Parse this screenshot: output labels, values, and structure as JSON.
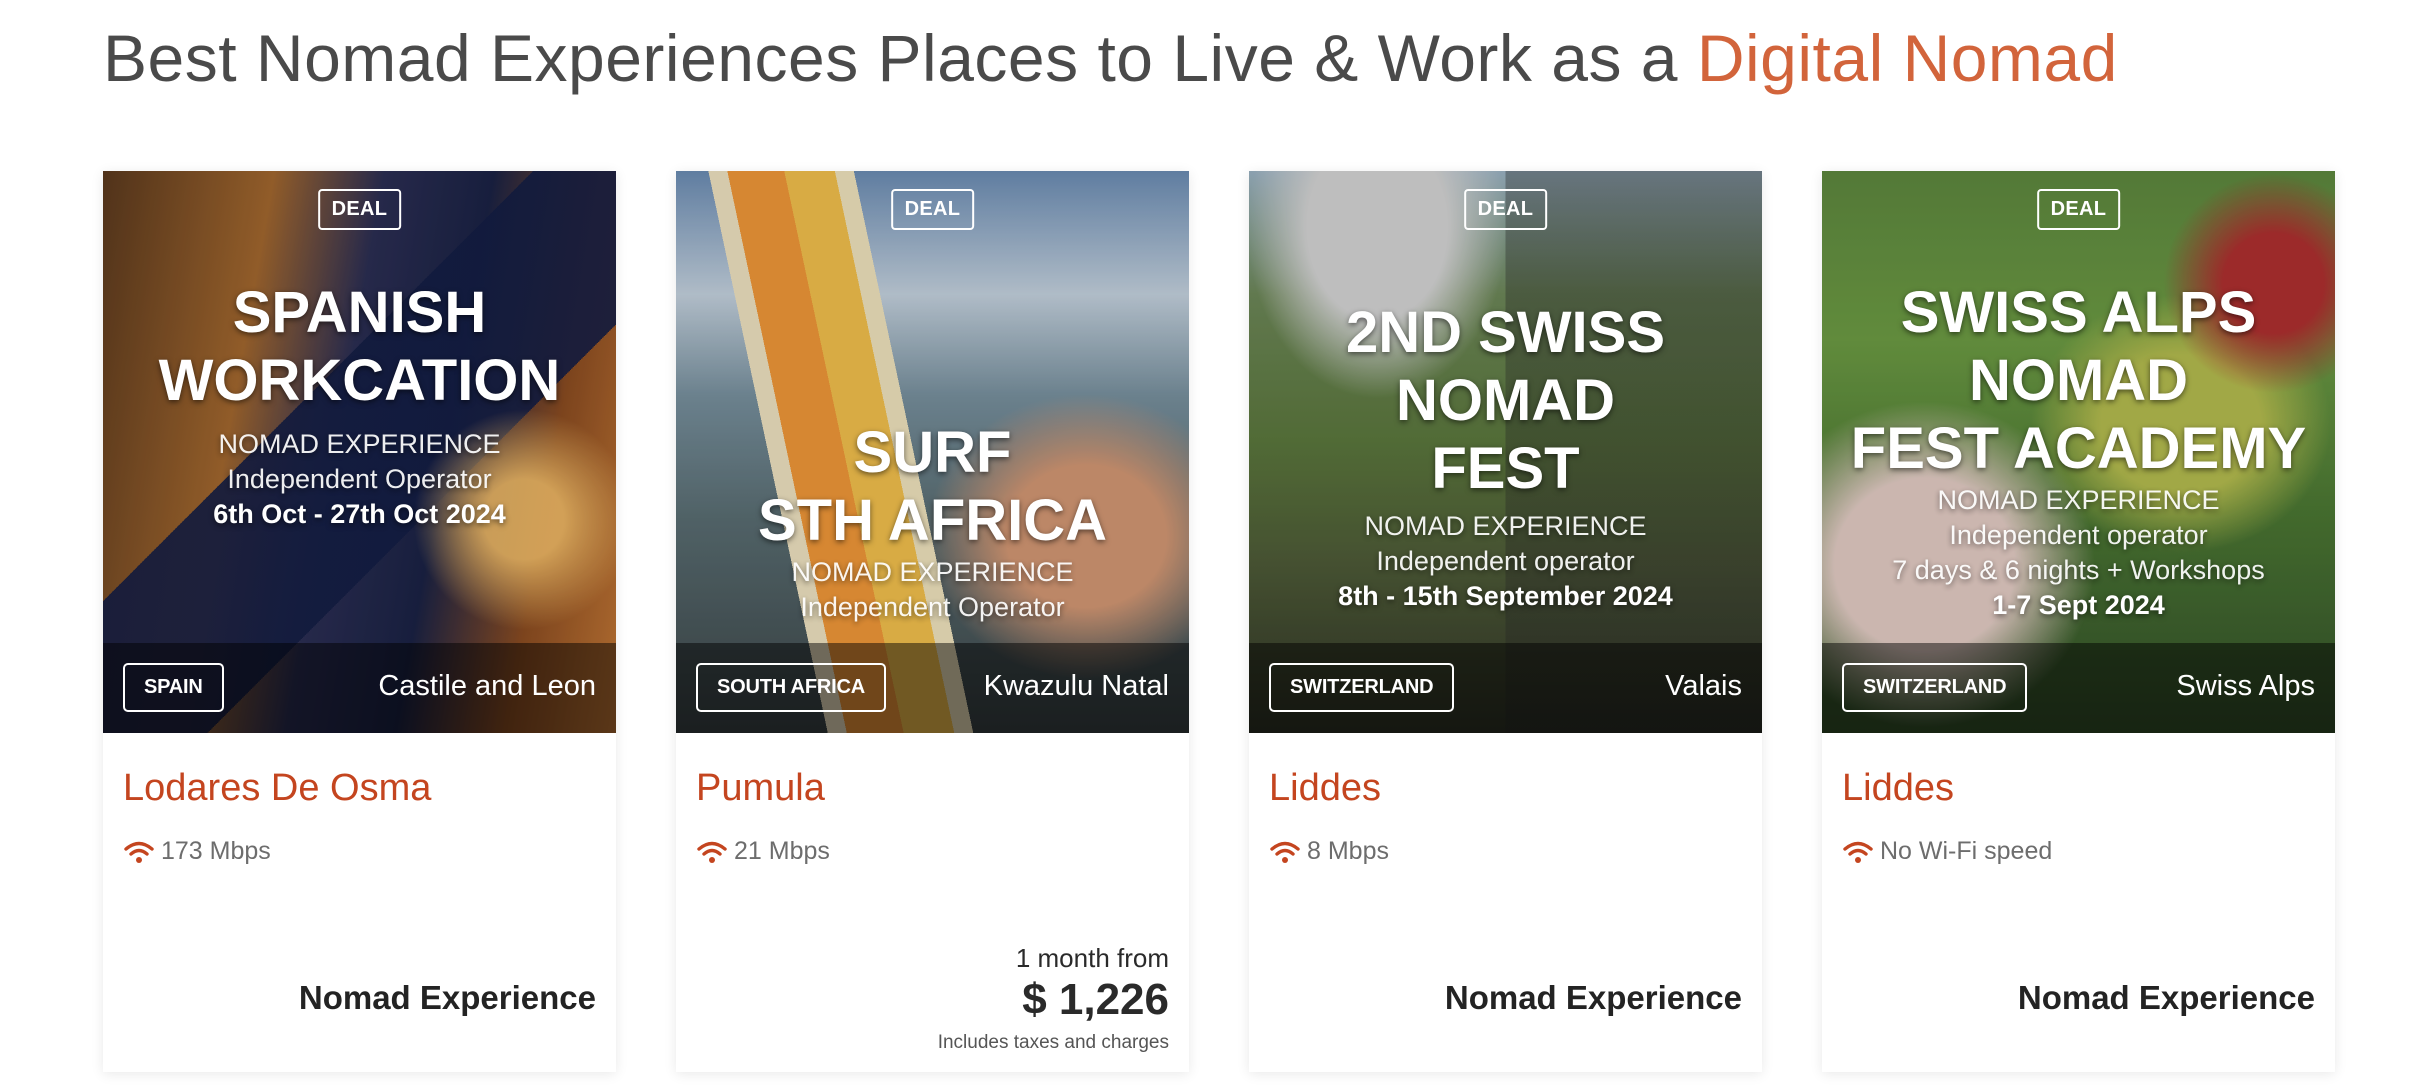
{
  "header": {
    "title_main": "Best Nomad Experiences Places to Live & Work as a ",
    "title_accent": "Digital Nomad"
  },
  "cards": [
    {
      "badge": "DEAL",
      "image_text": {
        "title_line1": "SPANISH",
        "title_line2": "WORKCATION",
        "sub1": "NOMAD EXPERIENCE",
        "sub2": "Independent Operator",
        "dates": "6th Oct - 27th Oct 2024"
      },
      "country": "SPAIN",
      "region": "Castile and Leon",
      "city": "Lodares De Osma",
      "wifi": "173 Mbps",
      "type": "Nomad Experience"
    },
    {
      "badge": "DEAL",
      "image_text": {
        "title_line1": "SURF",
        "title_line2": "STH AFRICA",
        "sub1": "NOMAD EXPERIENCE",
        "sub2": "Independent Operator"
      },
      "country": "SOUTH AFRICA",
      "region": "Kwazulu Natal",
      "city": "Pumula",
      "wifi": "21 Mbps",
      "price": {
        "from": "1 month from",
        "amount": "$ 1,226",
        "note": "Includes taxes and charges"
      }
    },
    {
      "badge": "DEAL",
      "image_text": {
        "title_line1": "2ND SWISS",
        "title_line2": "NOMAD",
        "title_line3": "FEST",
        "sub1": "NOMAD EXPERIENCE",
        "sub2": "Independent operator",
        "dates": "8th - 15th September 2024"
      },
      "country": "SWITZERLAND",
      "region": "Valais",
      "city": "Liddes",
      "wifi": "8 Mbps",
      "type": "Nomad Experience"
    },
    {
      "badge": "DEAL",
      "image_text": {
        "title_line1": "SWISS ALPS",
        "title_line2": "NOMAD",
        "title_line3": "FEST ACADEMY",
        "sub1": "NOMAD EXPERIENCE",
        "sub2": "Independent operator",
        "sub3": "7 days & 6 nights + Workshops",
        "dates": "1-7 Sept 2024"
      },
      "country": "SWITZERLAND",
      "region": "Swiss Alps",
      "city": "Liddes",
      "wifi": "No Wi-Fi speed",
      "type": "Nomad Experience"
    }
  ],
  "colors": {
    "accent": "#d2643b",
    "city": "#c4451f",
    "title": "#4a4a4a",
    "wifi_icon": "#c4451f"
  },
  "icons": {
    "wifi": "wifi-icon"
  }
}
